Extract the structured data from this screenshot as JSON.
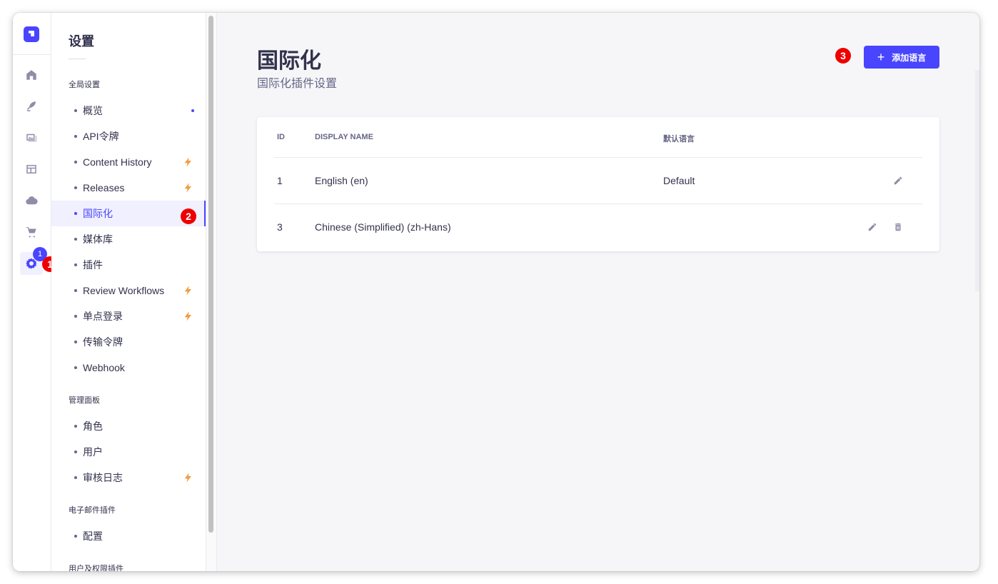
{
  "rail": {
    "items": [
      {
        "name": "home-icon"
      },
      {
        "name": "content-type-builder-icon"
      },
      {
        "name": "media-library-icon"
      },
      {
        "name": "content-manager-icon"
      },
      {
        "name": "cloud-icon"
      },
      {
        "name": "marketplace-icon"
      },
      {
        "name": "settings-icon"
      }
    ],
    "settings_badge": "1"
  },
  "markers": {
    "m1": "1",
    "m2": "2",
    "m3": "3"
  },
  "subnav": {
    "title": "设置",
    "sections": {
      "global": "全局设置",
      "admin": "管理面板",
      "email": "电子邮件插件",
      "users": "用户及权限插件"
    },
    "items": {
      "overview": "概览",
      "api_tokens": "API令牌",
      "content_history": "Content History",
      "releases": "Releases",
      "i18n": "国际化",
      "media": "媒体库",
      "plugins": "插件",
      "review": "Review Workflows",
      "sso": "单点登录",
      "transfer": "传输令牌",
      "webhook": "Webhook",
      "roles": "角色",
      "users": "用户",
      "audit": "审核日志",
      "config": "配置"
    }
  },
  "main": {
    "title": "国际化",
    "subtitle": "国际化插件设置",
    "add_button": "添加语言",
    "table": {
      "headers": {
        "id": "ID",
        "name": "DISPLAY NAME",
        "default": "默认语言"
      },
      "rows": [
        {
          "id": "1",
          "name": "English (en)",
          "default": "Default"
        },
        {
          "id": "3",
          "name": "Chinese (Simplified) (zh-Hans)",
          "default": ""
        }
      ]
    }
  },
  "colors": {
    "accent": "#4945ff",
    "marker": "#ee0000",
    "bolt": "#f29d41"
  }
}
